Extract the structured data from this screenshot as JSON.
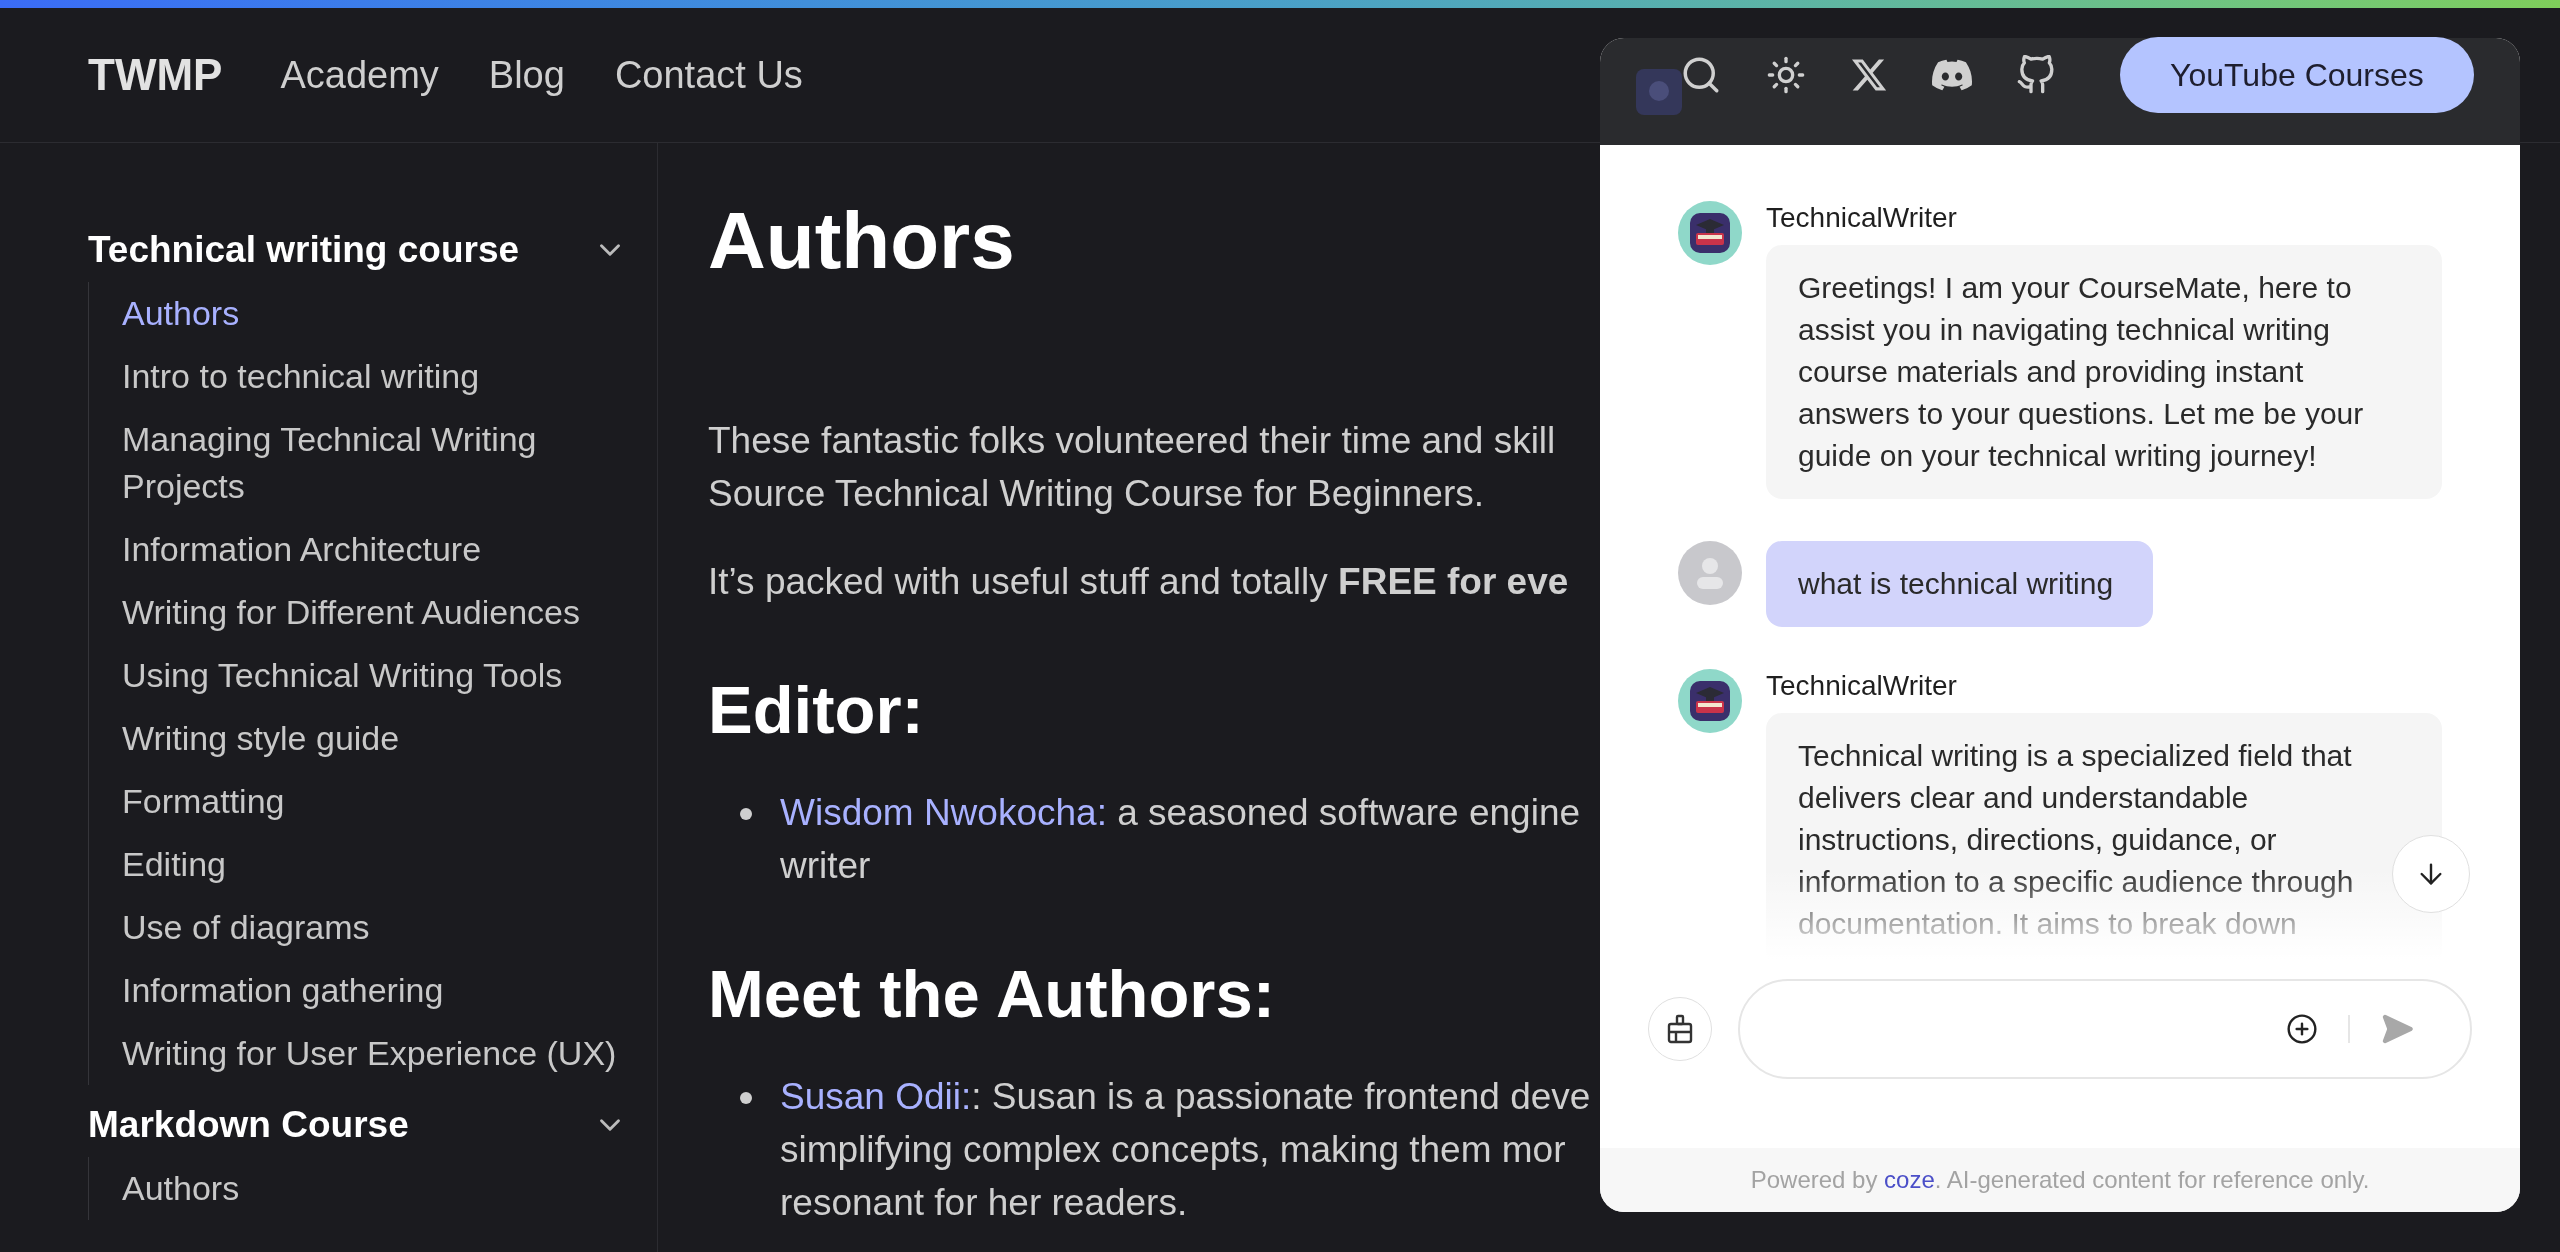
{
  "top_nav": {
    "logo": "TWMP",
    "links": [
      {
        "label": "Academy"
      },
      {
        "label": "Blog"
      },
      {
        "label": "Contact Us"
      }
    ],
    "cta": "YouTube Courses"
  },
  "sidebar": {
    "sections": [
      {
        "title": "Technical writing course",
        "expanded": true,
        "items": [
          {
            "label": "Authors",
            "selected": true
          },
          {
            "label": "Intro to technical writing",
            "selected": false
          },
          {
            "label": "Managing Technical Writing Projects",
            "selected": false
          },
          {
            "label": "Information Architecture",
            "selected": false
          },
          {
            "label": "Writing for Different Audiences",
            "selected": false
          },
          {
            "label": "Using Technical Writing Tools",
            "selected": false
          },
          {
            "label": "Writing style guide",
            "selected": false
          },
          {
            "label": "Formatting",
            "selected": false
          },
          {
            "label": "Editing",
            "selected": false
          },
          {
            "label": "Use of diagrams",
            "selected": false
          },
          {
            "label": "Information gathering",
            "selected": false
          },
          {
            "label": "Writing for User Experience (UX)",
            "selected": false
          }
        ]
      },
      {
        "title": "Markdown Course",
        "expanded": true,
        "items": [
          {
            "label": "Authors",
            "selected": false
          }
        ]
      }
    ]
  },
  "main": {
    "title": "Authors",
    "intro_lines": [
      "These fantastic folks volunteered their time and skill",
      "Source Technical Writing Course for Beginners."
    ],
    "packed": "It’s packed with useful stuff and totally **FREE for eve**",
    "sections": [
      {
        "heading": "Editor:",
        "items": [
          {
            "name": "Wisdom Nwokocha:",
            "lines": [
              " a seasoned software engine",
              "writer"
            ]
          }
        ]
      },
      {
        "heading": "Meet the Authors:",
        "items": [
          {
            "name": "Susan Odii:",
            "lines": [
              ": Susan is a passionate frontend deve",
              "simplifying complex concepts, making them mor",
              "resonant for her readers."
            ]
          }
        ]
      }
    ]
  },
  "chat": {
    "messages": [
      {
        "kind": "bot",
        "name": "TechnicalWriter",
        "text": "Greetings! I am your CourseMate, here to assist you in navigating technical writing course materials and providing instant answers to your questions. Let me be your guide on your technical writing journey!"
      },
      {
        "kind": "user",
        "text": "what is technical writing"
      },
      {
        "kind": "bot",
        "name": "TechnicalWriter",
        "text": "Technical writing is a specialized field that delivers clear and understandable instructions, directions, guidance, or information to a specific audience through documentation. It aims to break down"
      }
    ],
    "footer": {
      "before": "Powered by ",
      "link": "coze",
      "after": ". AI-generated content for reference only."
    }
  }
}
